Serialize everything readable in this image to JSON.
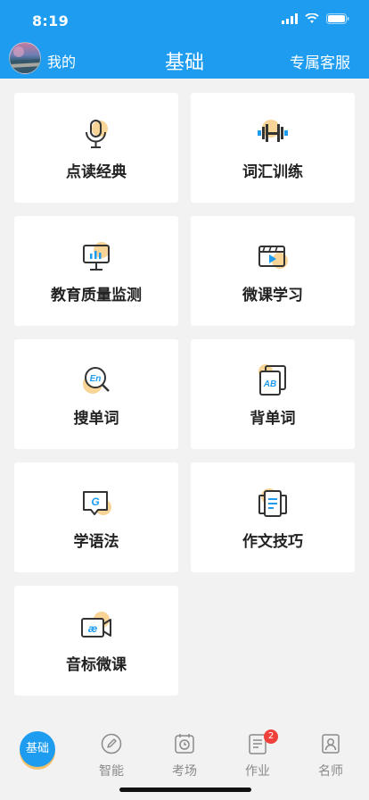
{
  "status_bar": {
    "time": "8:19"
  },
  "header": {
    "mine_label": "我的",
    "title": "基础",
    "service_label": "专属客服"
  },
  "cards": [
    {
      "label": "点读经典",
      "icon": "microphone-icon"
    },
    {
      "label": "词汇训练",
      "icon": "dumbbell-icon"
    },
    {
      "label": "教育质量监测",
      "icon": "presentation-chart-icon"
    },
    {
      "label": "微课学习",
      "icon": "video-player-icon"
    },
    {
      "label": "搜单词",
      "icon": "search-word-icon",
      "glyph": "En"
    },
    {
      "label": "背单词",
      "icon": "flashcards-icon",
      "glyph": "AB"
    },
    {
      "label": "学语法",
      "icon": "grammar-chat-icon",
      "glyph": "G"
    },
    {
      "label": "作文技巧",
      "icon": "documents-icon"
    },
    {
      "label": "音标微课",
      "icon": "phonetic-video-icon",
      "glyph": "æ"
    }
  ],
  "tabs": [
    {
      "label": "基础",
      "icon": "home-circle-icon",
      "active": true
    },
    {
      "label": "智能",
      "icon": "pencil-circle-icon"
    },
    {
      "label": "考场",
      "icon": "exam-clock-icon"
    },
    {
      "label": "作业",
      "icon": "homework-icon",
      "badge": "2"
    },
    {
      "label": "名师",
      "icon": "teacher-card-icon"
    }
  ],
  "colors": {
    "primary": "#1e9cf0",
    "accent": "#f5c26b",
    "badge": "#f0403c"
  }
}
